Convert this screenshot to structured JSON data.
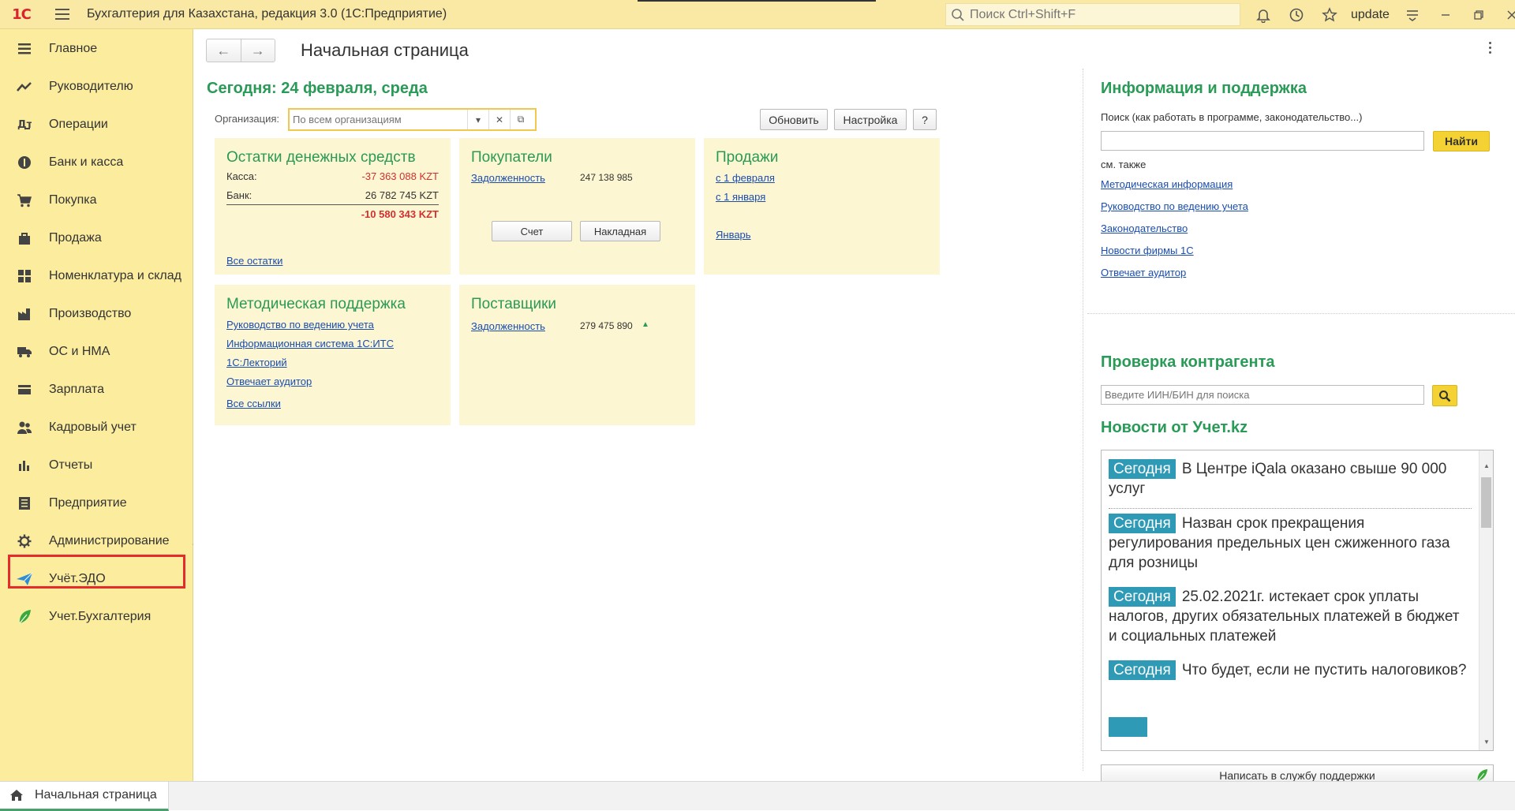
{
  "app": {
    "logo": "1С",
    "title": "Бухгалтерия для Казахстана, редакция 3.0  (1С:Предприятие)",
    "search_placeholder": "Поиск Ctrl+Shift+F",
    "user": "update"
  },
  "sidebar": {
    "items": [
      {
        "label": "Главное",
        "icon": "menu-lines-icon"
      },
      {
        "label": "Руководителю",
        "icon": "trend-chart-icon"
      },
      {
        "label": "Операции",
        "icon": "operations-icon"
      },
      {
        "label": "Банк и касса",
        "icon": "coins-icon"
      },
      {
        "label": "Покупка",
        "icon": "cart-icon"
      },
      {
        "label": "Продажа",
        "icon": "bag-icon"
      },
      {
        "label": "Номенклатура и склад",
        "icon": "grid-icon"
      },
      {
        "label": "Производство",
        "icon": "factory-icon"
      },
      {
        "label": "ОС и НМА",
        "icon": "truck-icon"
      },
      {
        "label": "Зарплата",
        "icon": "wallet-icon"
      },
      {
        "label": "Кадровый учет",
        "icon": "people-icon"
      },
      {
        "label": "Отчеты",
        "icon": "bar-chart-icon"
      },
      {
        "label": "Предприятие",
        "icon": "building-icon"
      },
      {
        "label": "Администрирование",
        "icon": "gear-icon"
      },
      {
        "label": "Учёт.ЭДО",
        "icon": "paper-plane-icon"
      },
      {
        "label": "Учет.Бухгалтерия",
        "icon": "leaf-icon"
      }
    ]
  },
  "bottom": {
    "tab_label": "Начальная страница"
  },
  "main": {
    "title": "Начальная страница",
    "today": "Сегодня: 24 февраля, среда",
    "org_label": "Организация:",
    "org_placeholder": "По всем организациям",
    "buttons": {
      "refresh": "Обновить",
      "settings": "Настройка",
      "help": "?"
    },
    "cash": {
      "title": "Остатки денежных средств",
      "kassa_label": "Касса:",
      "kassa_value": "-37 363 088 KZT",
      "bank_label": "Банк:",
      "bank_value": "26 782 745 KZT",
      "total_value": "-10 580 343 KZT",
      "link": "Все остатки"
    },
    "buyers": {
      "title": "Покупатели",
      "debt_label": "Задолженность",
      "debt_value": "247 138 985",
      "btn_invoice": "Счет",
      "btn_waybill": "Накладная"
    },
    "sales": {
      "title": "Продажи",
      "links": [
        "с 1 февраля",
        "с 1 января",
        "Январь"
      ]
    },
    "method": {
      "title": "Методическая поддержка",
      "links": [
        "Руководство по ведению учета",
        "Информационная система 1С:ИТС",
        "1С:Лекторий",
        "Отвечает аудитор",
        "Все ссылки"
      ]
    },
    "suppliers": {
      "title": "Поставщики",
      "debt_label": "Задолженность",
      "debt_value": "279 475 890",
      "arrow": "▲"
    }
  },
  "right": {
    "info_title": "Информация и поддержка",
    "search_hint": "Поиск (как работать в программе, законодательство...)",
    "find_label": "Найти",
    "see_also": "см. также",
    "links": [
      "Методическая информация",
      "Руководство по ведению учета",
      "Законодательство",
      "Новости фирмы 1С",
      "Отвечает аудитор"
    ],
    "check_title": "Проверка контрагента",
    "check_placeholder": "Введите ИИН/БИН для поиска",
    "news_title": "Новости от Учет.kz",
    "news": [
      {
        "badge": "Сегодня",
        "text": "В Центре iQala оказано свыше 90 000 услуг"
      },
      {
        "badge": "Сегодня",
        "text": "Назван срок прекращения регулирования предельных цен сжиженного газа для розницы"
      },
      {
        "badge": "Сегодня",
        "text": "25.02.2021г. истекает срок уплаты налогов, других обязательных платежей в бюджет и социальных платежей"
      },
      {
        "badge": "Сегодня",
        "text": "Что будет, если не пустить налоговиков?"
      }
    ],
    "support_btn": "Написать в службу поддержки"
  },
  "colors": {
    "accent_green": "#2a9a57",
    "sidebar_bg": "#fbec9e",
    "card_bg": "#fdf6d2",
    "badge": "#2e9ab5",
    "highlight_red": "#e52b2b"
  }
}
